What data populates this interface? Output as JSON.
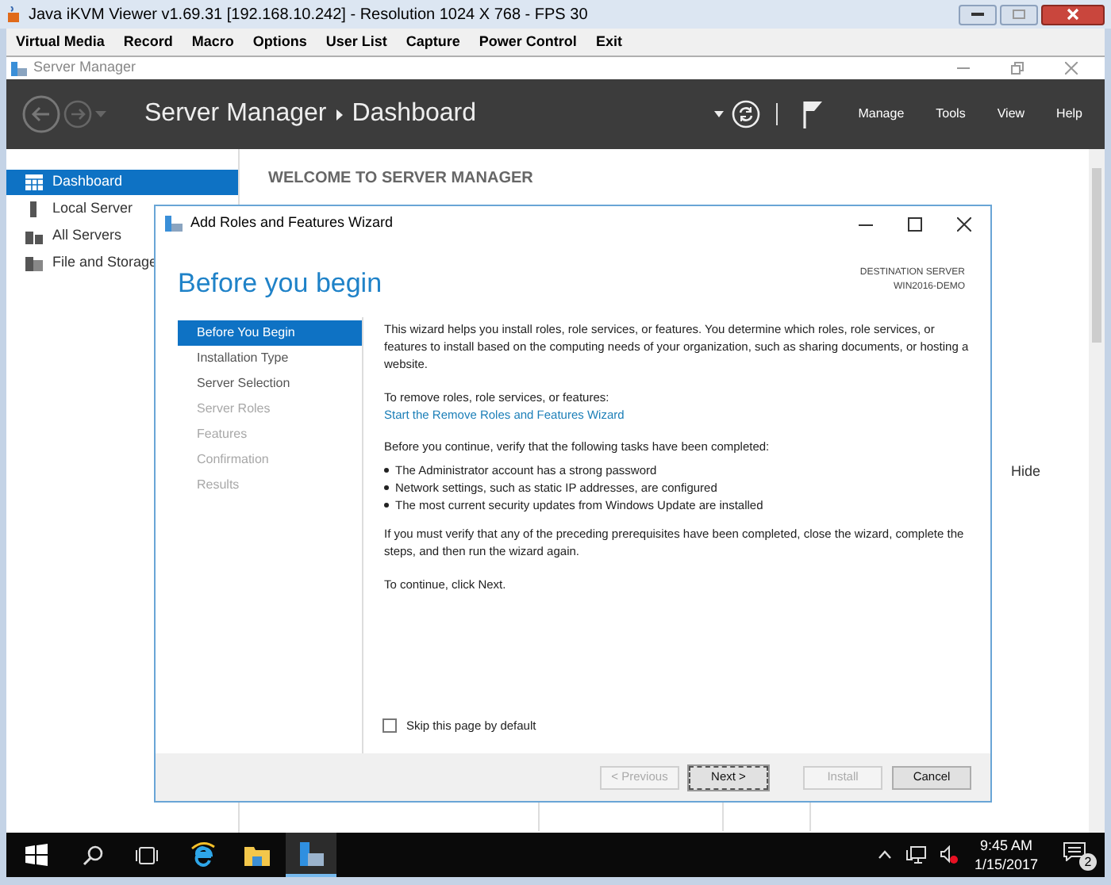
{
  "viewer": {
    "title": "Java iKVM Viewer v1.69.31 [192.168.10.242]  - Resolution 1024 X 768 - FPS 30",
    "menu": [
      "Virtual Media",
      "Record",
      "Macro",
      "Options",
      "User List",
      "Capture",
      "Power Control",
      "Exit"
    ]
  },
  "server_manager": {
    "title": "Server Manager",
    "breadcrumb": [
      "Server Manager",
      "Dashboard"
    ],
    "menu": [
      "Manage",
      "Tools",
      "View",
      "Help"
    ],
    "sidebar": [
      {
        "label": "Dashboard",
        "selected": true
      },
      {
        "label": "Local Server",
        "selected": false
      },
      {
        "label": "All Servers",
        "selected": false
      },
      {
        "label": "File and Storage",
        "selected": false
      }
    ],
    "welcome": "WELCOME TO SERVER MANAGER",
    "hide": "Hide"
  },
  "wizard": {
    "title": "Add Roles and Features Wizard",
    "heading": "Before you begin",
    "destination_label": "DESTINATION SERVER",
    "destination_server": "WIN2016-DEMO",
    "steps": [
      {
        "label": "Before You Begin",
        "selected": true,
        "disabled": false
      },
      {
        "label": "Installation Type",
        "selected": false,
        "disabled": false
      },
      {
        "label": "Server Selection",
        "selected": false,
        "disabled": false
      },
      {
        "label": "Server Roles",
        "selected": false,
        "disabled": true
      },
      {
        "label": "Features",
        "selected": false,
        "disabled": true
      },
      {
        "label": "Confirmation",
        "selected": false,
        "disabled": true
      },
      {
        "label": "Results",
        "selected": false,
        "disabled": true
      }
    ],
    "intro": "This wizard helps you install roles, role services, or features. You determine which roles, role services, or features to install based on the computing needs of your organization, such as sharing documents, or hosting a website.",
    "remove_label": "To remove roles, role services, or features:",
    "remove_link": "Start the Remove Roles and Features Wizard",
    "verify": "Before you continue, verify that the following tasks have been completed:",
    "tasks": [
      "The Administrator account has a strong password",
      "Network settings, such as static IP addresses, are configured",
      "The most current security updates from Windows Update are installed"
    ],
    "note": "If you must verify that any of the preceding prerequisites have been completed, close the wizard, complete the steps, and then run the wizard again.",
    "continue": "To continue, click Next.",
    "skip": {
      "label": "Skip this page by default",
      "checked": false
    },
    "buttons": [
      {
        "label": "< Previous",
        "disabled": true,
        "default": false
      },
      {
        "label": "Next >",
        "disabled": false,
        "default": true
      },
      {
        "label": "Install",
        "disabled": true,
        "default": false
      },
      {
        "label": "Cancel",
        "disabled": false,
        "default": false
      }
    ]
  },
  "taskbar": {
    "time": "9:45 AM",
    "date": "1/15/2017",
    "notifications": "2"
  }
}
